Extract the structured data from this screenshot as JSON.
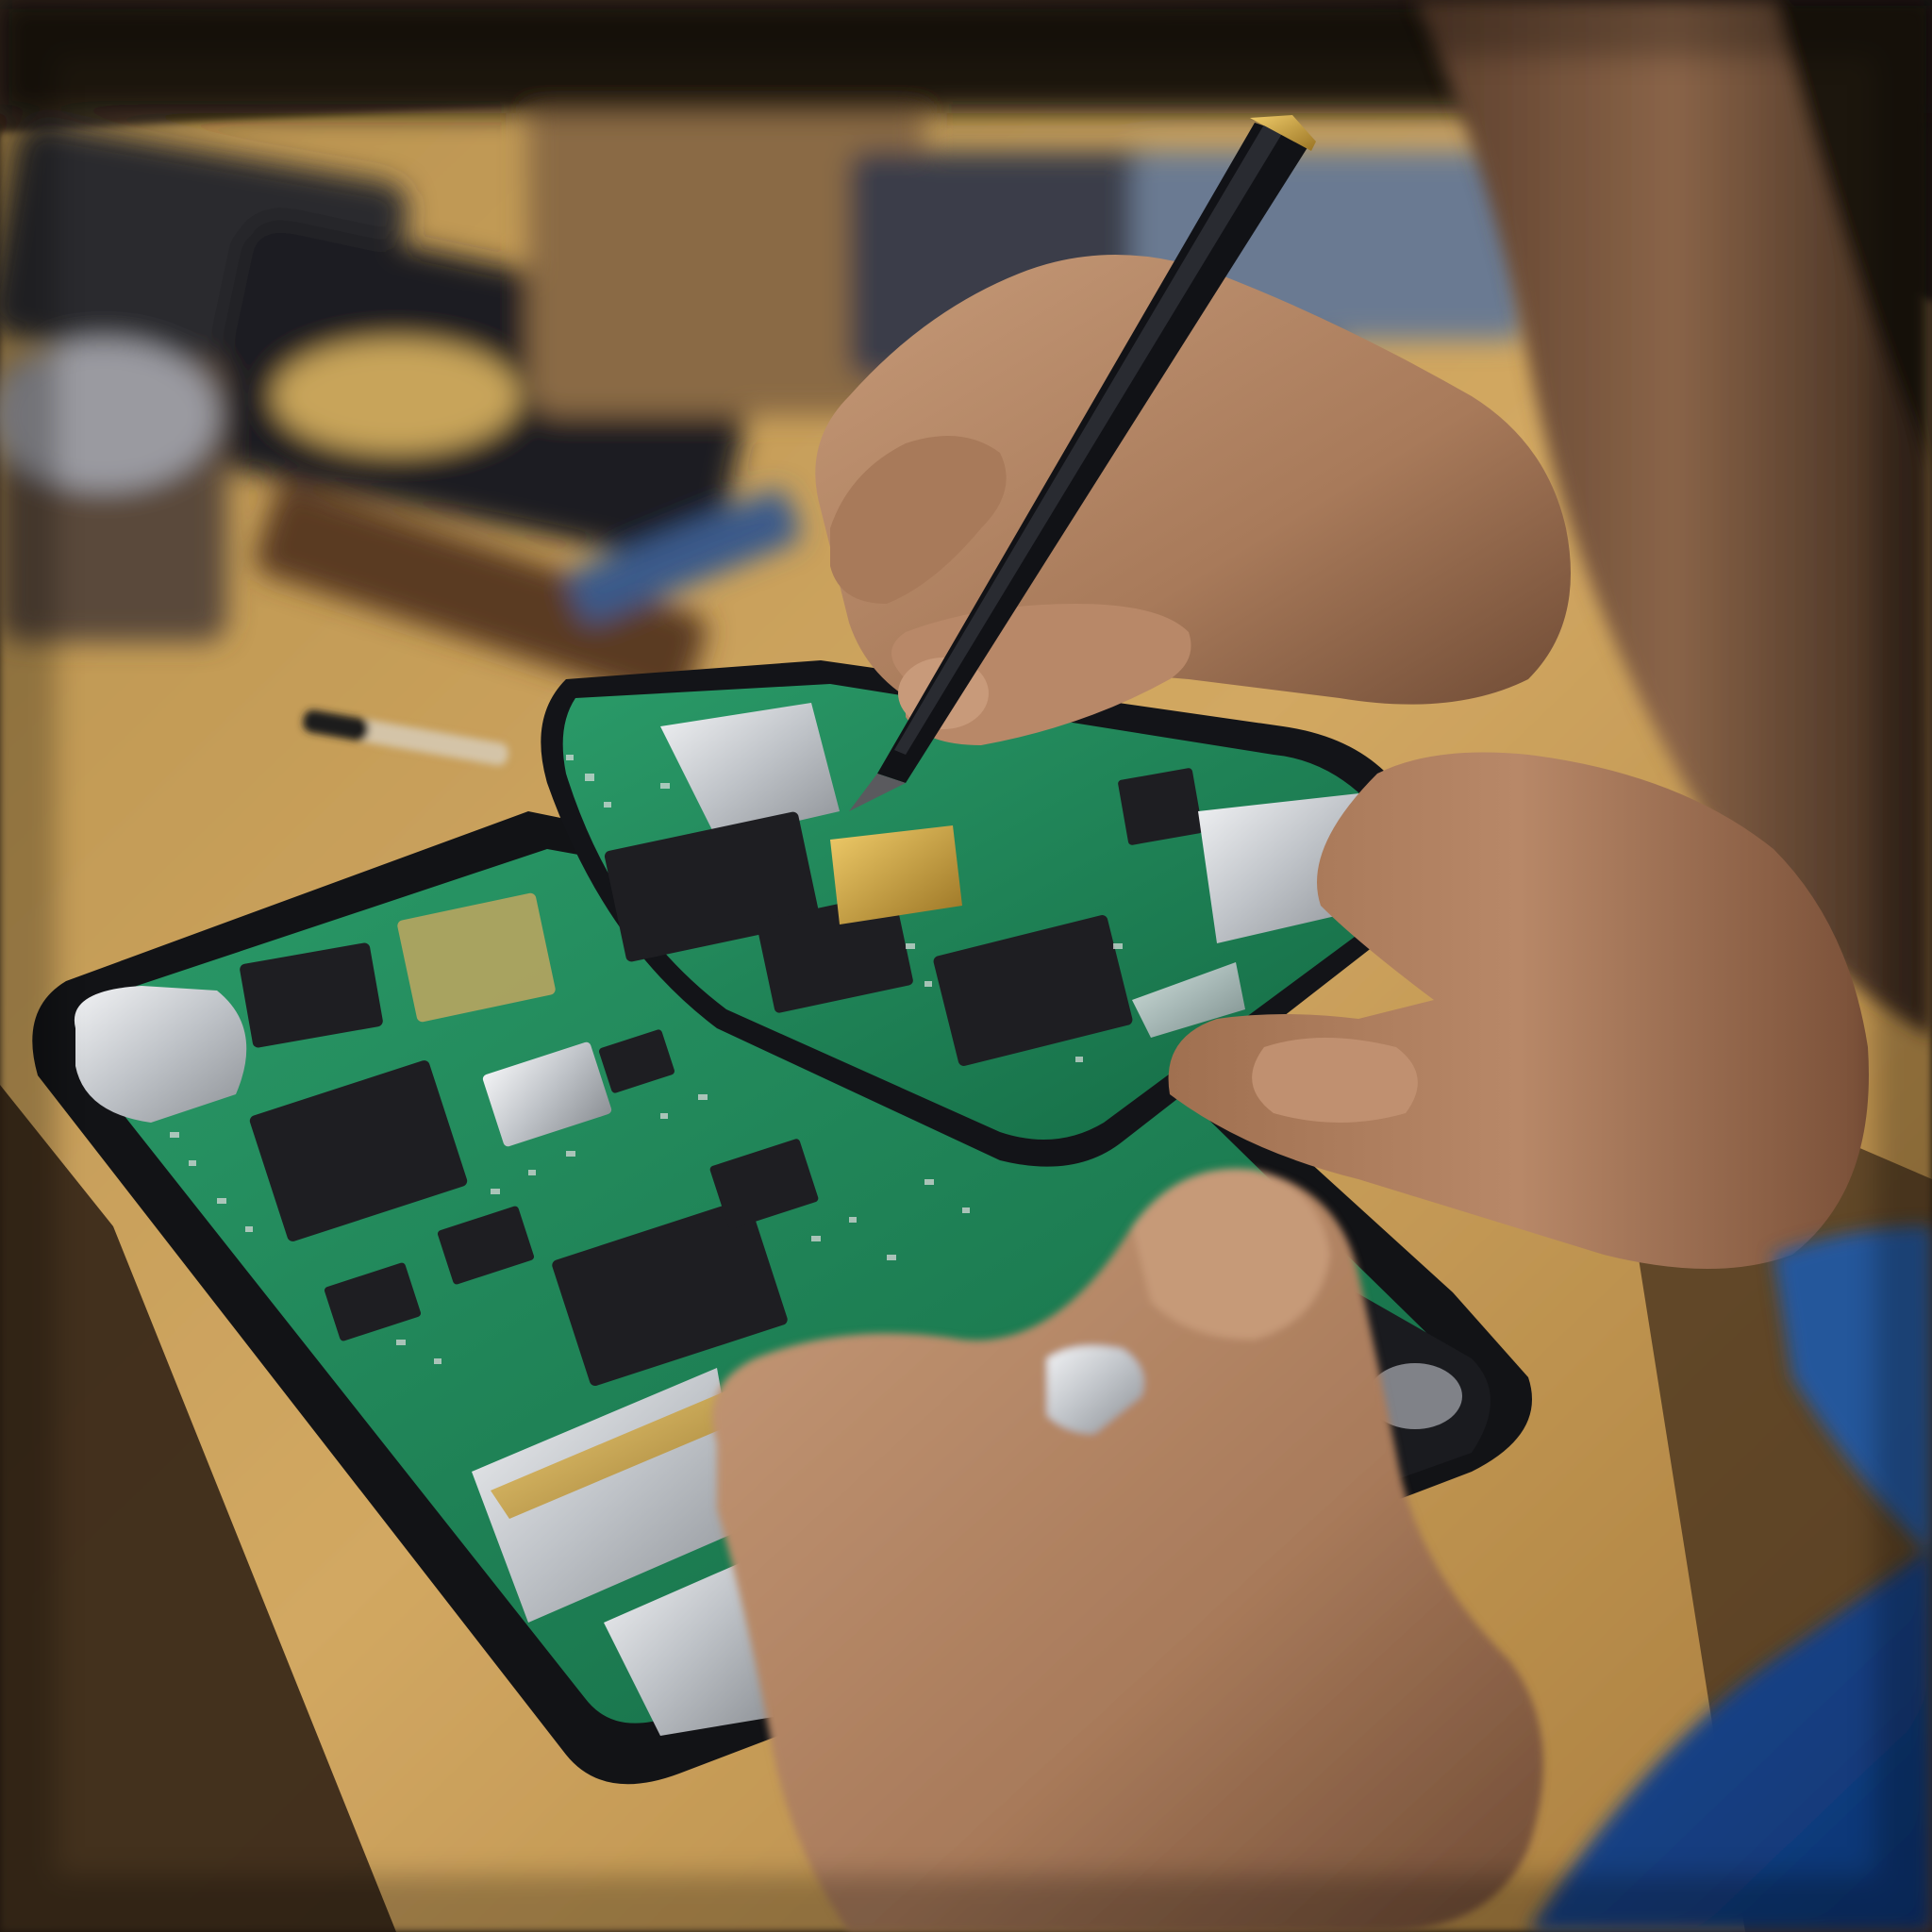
{
  "image": {
    "kind": "photograph",
    "text_visible": [],
    "colors": {
      "table_wood": "#c9a05a",
      "table_shadow": "#8a6430",
      "background_dark": "#2a221a",
      "pcb_green": "#1f8a5a",
      "pcb_dark_green": "#0f5a3a",
      "chip_black": "#1e1e22",
      "phone_frame": "#15161a",
      "silver_shield": "#cfd2d6",
      "gold_connector": "#c9a23a",
      "skin": "#b88868",
      "skin_shadow": "#7a5038",
      "sleeve_blue": "#1d5aa8",
      "pen_black": "#101014",
      "pen_tip": "#c8a040"
    }
  }
}
